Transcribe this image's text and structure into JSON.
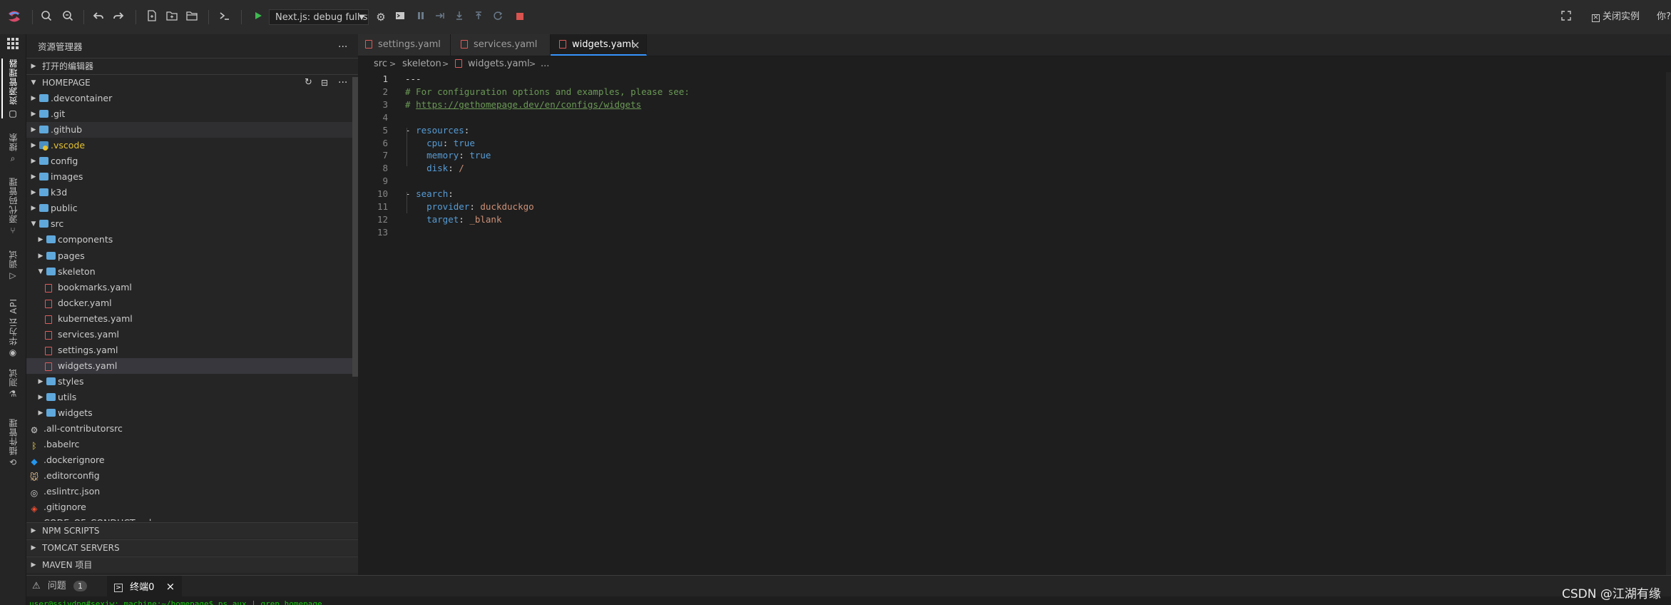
{
  "toolbar": {
    "run_config": "Next.js: debug full st",
    "fullscreen_icon": "fullscreen-icon",
    "close_instance": "关闭实例",
    "right_cut": "你?"
  },
  "activity": {
    "items": [
      {
        "label": "资源管理器",
        "icon": "files-icon"
      },
      {
        "label": "搜索",
        "icon": "search-icon"
      },
      {
        "label": "源代码管理",
        "icon": "source-control-icon"
      },
      {
        "label": "调试",
        "icon": "debug-icon"
      },
      {
        "label": "华为云 API",
        "icon": "api-icon"
      },
      {
        "label": "测试",
        "icon": "beaker-icon"
      },
      {
        "label": "插件管理",
        "icon": "extensions-icon"
      }
    ]
  },
  "sidebar": {
    "title": "资源管理器",
    "more": "···",
    "open_editors": "打开的编辑器",
    "project": "HOMEPAGE",
    "tree": [
      {
        "label": ".devcontainer",
        "type": "folder",
        "depth": 0,
        "state": "closed"
      },
      {
        "label": ".git",
        "type": "folder",
        "depth": 0,
        "state": "closed"
      },
      {
        "label": ".github",
        "type": "folder",
        "depth": 0,
        "state": "closed",
        "hover": true
      },
      {
        "label": ".vscode",
        "type": "folder",
        "depth": 0,
        "state": "closed",
        "special": true
      },
      {
        "label": "config",
        "type": "folder",
        "depth": 0,
        "state": "closed"
      },
      {
        "label": "images",
        "type": "folder",
        "depth": 0,
        "state": "closed"
      },
      {
        "label": "k3d",
        "type": "folder",
        "depth": 0,
        "state": "closed"
      },
      {
        "label": "public",
        "type": "folder",
        "depth": 0,
        "state": "closed"
      },
      {
        "label": "src",
        "type": "folder",
        "depth": 0,
        "state": "open"
      },
      {
        "label": "components",
        "type": "folder",
        "depth": 1,
        "state": "closed"
      },
      {
        "label": "pages",
        "type": "folder",
        "depth": 1,
        "state": "closed"
      },
      {
        "label": "skeleton",
        "type": "folder",
        "depth": 1,
        "state": "open"
      },
      {
        "label": "bookmarks.yaml",
        "type": "yaml",
        "depth": 2
      },
      {
        "label": "docker.yaml",
        "type": "yaml",
        "depth": 2
      },
      {
        "label": "kubernetes.yaml",
        "type": "yaml",
        "depth": 2
      },
      {
        "label": "services.yaml",
        "type": "yaml",
        "depth": 2
      },
      {
        "label": "settings.yaml",
        "type": "yaml",
        "depth": 2
      },
      {
        "label": "widgets.yaml",
        "type": "yaml",
        "depth": 2,
        "selected": true
      },
      {
        "label": "styles",
        "type": "folder",
        "depth": 1,
        "state": "closed"
      },
      {
        "label": "utils",
        "type": "folder",
        "depth": 1,
        "state": "closed"
      },
      {
        "label": "widgets",
        "type": "folder",
        "depth": 1,
        "state": "closed"
      },
      {
        "label": ".all-contributorsrc",
        "type": "gear",
        "depth": 0
      },
      {
        "label": ".babelrc",
        "type": "babel",
        "depth": 0
      },
      {
        "label": ".dockerignore",
        "type": "docker",
        "depth": 0
      },
      {
        "label": ".editorconfig",
        "type": "editorconfig",
        "depth": 0
      },
      {
        "label": ".eslintrc.json",
        "type": "eslint",
        "depth": 0
      },
      {
        "label": ".gitignore",
        "type": "git",
        "depth": 0
      },
      {
        "label": "CODE_OF_CONDUCT.md",
        "type": "md",
        "depth": 0,
        "clipped": true
      }
    ],
    "sections": [
      "NPM SCRIPTS",
      "TOMCAT SERVERS",
      "MAVEN 项目"
    ]
  },
  "tabs": [
    {
      "label": "settings.yaml",
      "active": false
    },
    {
      "label": "services.yaml",
      "active": false
    },
    {
      "label": "widgets.yaml",
      "active": true
    }
  ],
  "breadcrumb": [
    "src",
    "skeleton",
    "widgets.yaml",
    "..."
  ],
  "editor": {
    "lines": [
      "---",
      "# For configuration options and examples, please see:",
      "# https://gethomepage.dev/en/configs/widgets",
      "",
      "- resources:",
      "    cpu: true",
      "    memory: true",
      "    disk: /",
      "",
      "- search:",
      "    provider: duckduckgo",
      "    target: _blank",
      ""
    ],
    "current_line": 1
  },
  "panel": {
    "problems_label": "问题",
    "problems_count": "1",
    "terminal_label": "终端0",
    "terminal_line": "user@ssivdpq#sexiw: machine:~/homepage$ ps aux | grep homepage"
  },
  "watermark": "CSDN @江湖有缘",
  "colors": {
    "accent": "#3794ff",
    "folder": "#5fa8dc",
    "yaml": "#e05a5a",
    "run_green": "#3fb950",
    "stop_red": "#d9534f"
  }
}
